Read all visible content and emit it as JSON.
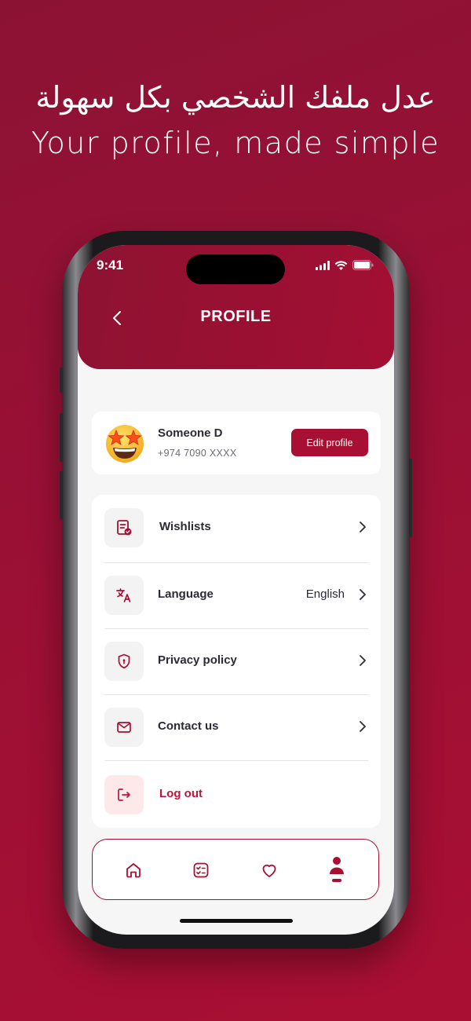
{
  "marketing": {
    "headline_ar": "عدل ملفك الشخصي بكل سهولة",
    "headline_en": "Your profile, made simple"
  },
  "status_bar": {
    "time": "9:41",
    "icons": [
      "signal-icon",
      "wifi-icon",
      "battery-icon"
    ]
  },
  "header": {
    "title": "PROFILE",
    "back_icon": "chevron-left-icon"
  },
  "profile": {
    "name": "Someone D",
    "phone": "+974 7090 XXXX",
    "avatar_icon": "star-struck-emoji-icon",
    "edit_label": "Edit profile"
  },
  "menu": {
    "items": [
      {
        "label": "Wishlists",
        "icon": "wishlist-icon",
        "value": ""
      },
      {
        "label": "Language",
        "icon": "translate-icon",
        "value": "English"
      },
      {
        "label": "Privacy policy",
        "icon": "shield-icon",
        "value": ""
      },
      {
        "label": "Contact us",
        "icon": "mail-icon",
        "value": ""
      }
    ],
    "logout_label": "Log out",
    "logout_icon": "logout-icon"
  },
  "tabs": [
    {
      "name": "home",
      "icon": "home-icon",
      "active": false
    },
    {
      "name": "orders",
      "icon": "checklist-icon",
      "active": false
    },
    {
      "name": "favorites",
      "icon": "heart-icon",
      "active": false
    },
    {
      "name": "profile",
      "icon": "user-icon",
      "active": true
    }
  ],
  "colors": {
    "brand": "#a90f33",
    "background": "#9a1035",
    "logout_text": "#c0143d",
    "logout_bg": "#fde9ea"
  }
}
